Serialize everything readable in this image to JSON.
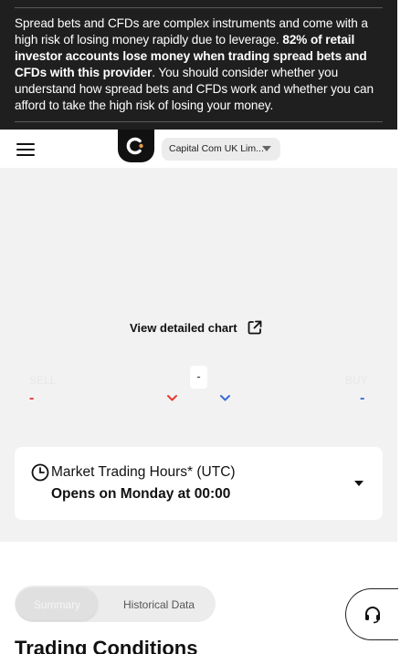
{
  "risk_warning": {
    "text_before": "Spread bets and CFDs are complex instruments and come with a high risk of losing money rapidly due to leverage. ",
    "text_bold": "82% of retail investor accounts lose money when trading spread bets and CFDs with this provider",
    "text_after": ". You should consider whether you understand how spread bets and CFDs work and whether you can afford to take the high risk of losing your money."
  },
  "header": {
    "menu_icon": "hamburger-menu-icon",
    "logo_icon": "capital-com-logo",
    "entity_selected": "Capital Com UK Lim..."
  },
  "chart": {
    "detailed_link": "View detailed chart",
    "link_icon": "external-link-icon"
  },
  "quote": {
    "sell_label": "SELL",
    "sell_value": "-",
    "buy_label": "BUY",
    "buy_value": "-",
    "spread_value": "-",
    "sell_color": "#e8392f",
    "buy_color": "#3b6cd8"
  },
  "market_hours": {
    "title": "Market Trading Hours* (UTC)",
    "status": "Opens on Monday at 00:00",
    "clock_icon": "clock-icon"
  },
  "tabs": [
    {
      "label": "Summary",
      "active": true
    },
    {
      "label": "Historical Data",
      "active": false
    }
  ],
  "support": {
    "icon": "headset-icon"
  },
  "section": {
    "title": "Trading Conditions"
  }
}
